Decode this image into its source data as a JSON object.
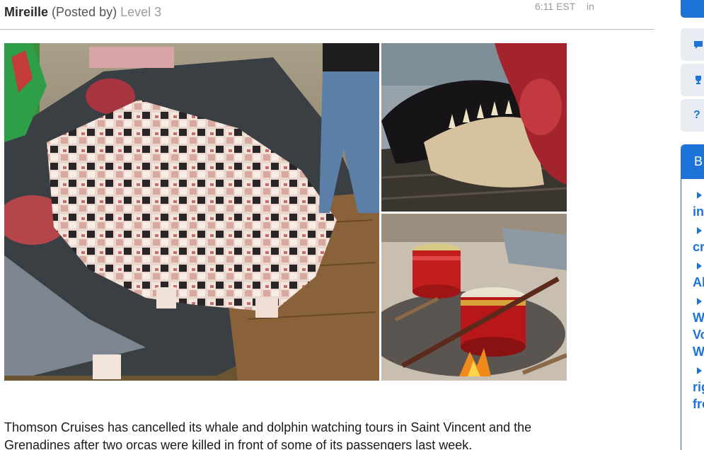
{
  "post": {
    "author": "Mireille",
    "posted_by": "(Posted by)",
    "level": "Level 3",
    "time": "6:11 EST",
    "in_label": "in"
  },
  "article": {
    "text": "Thomson Cruises has cancelled its whale and dolphin watching tours in Saint Vincent and the Grenadines after two orcas were killed in front of some of its passengers last week."
  },
  "sidebar": {
    "icons": [
      "comment-icon",
      "trophy-icon",
      "help-icon"
    ],
    "help_glyph": "?",
    "panel_title": "B",
    "items": [
      {
        "label": "in"
      },
      {
        "label": "cr"
      },
      {
        "label": "Al"
      },
      {
        "label": "W Vo W"
      },
      {
        "label": "rig fre"
      }
    ]
  },
  "colors": {
    "accent": "#1e73d8",
    "muted_text": "#9a9a9a"
  }
}
